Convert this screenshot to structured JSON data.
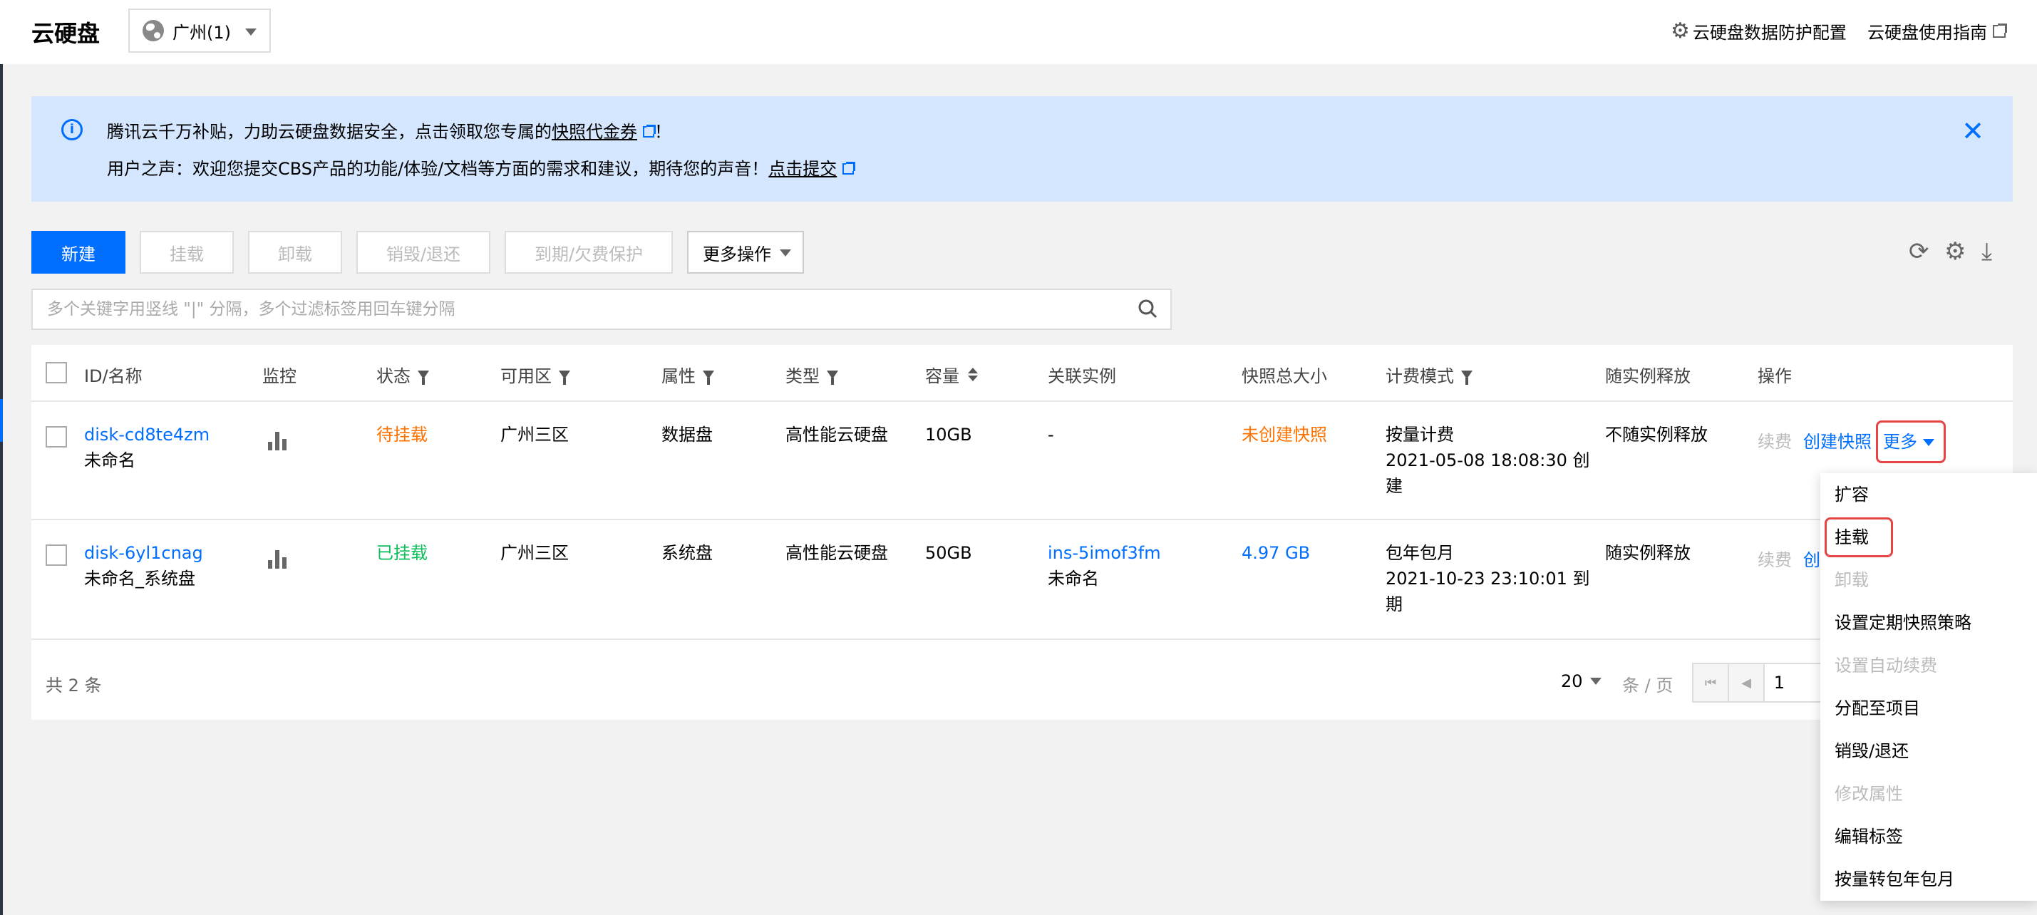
{
  "header": {
    "title": "云硬盘",
    "region": "广州(1)",
    "links": {
      "protection_config": "云硬盘数据防护配置",
      "guide": "云硬盘使用指南"
    }
  },
  "notice": {
    "line1_prefix": "腾讯云千万补贴，力助云硬盘数据安全，点击领取您专属的",
    "line1_link": "快照代金券",
    "line1_suffix": "！",
    "line2_prefix": "用户之声：欢迎您提交CBS产品的功能/体验/文档等方面的需求和建议，期待您的声音！",
    "line2_link": "点击提交",
    "close": "✕"
  },
  "toolbar": {
    "new": "新建",
    "mount": "挂载",
    "unmount": "卸载",
    "destroy": "销毁/退还",
    "expire_protect": "到期/欠费保护",
    "more_ops": "更多操作"
  },
  "search": {
    "placeholder": "多个关键字用竖线 \"|\" 分隔，多个过滤标签用回车键分隔"
  },
  "table": {
    "headers": {
      "id_name": "ID/名称",
      "monitor": "监控",
      "status": "状态",
      "zone": "可用区",
      "attr": "属性",
      "type": "类型",
      "capacity": "容量",
      "instance": "关联实例",
      "snapshot": "快照总大小",
      "billing": "计费模式",
      "release": "随实例释放",
      "ops": "操作"
    },
    "rows": [
      {
        "id": "disk-cd8te4zm",
        "name": "未命名",
        "status": "待挂载",
        "zone": "广州三区",
        "attr": "数据盘",
        "type": "高性能云硬盘",
        "capacity": "10GB",
        "instance": "-",
        "instance_name": "",
        "snapshot": "未创建快照",
        "billing": "按量计费",
        "billing_time_1": "2021-05-08 18:08:30 创",
        "billing_time_2": "建",
        "release": "不随实例释放",
        "op_renew": "续费",
        "op_snapshot": "创建快照",
        "op_more": "更多"
      },
      {
        "id": "disk-6yl1cnag",
        "name": "未命名_系统盘",
        "status": "已挂载",
        "zone": "广州三区",
        "attr": "系统盘",
        "type": "高性能云硬盘",
        "capacity": "50GB",
        "instance": "ins-5imof3fm",
        "instance_name": "未命名",
        "snapshot": "4.97 GB",
        "billing": "包年包月",
        "billing_time_1": "2021-10-23 23:10:01 到",
        "billing_time_2": "期",
        "release": "随实例释放",
        "op_renew": "续费",
        "op_snapshot": "创"
      }
    ],
    "footer": {
      "total": "共 2 条",
      "page_size": "20",
      "per_page": "条 / 页",
      "page": "1"
    }
  },
  "more_menu": {
    "items": [
      {
        "label": "扩容",
        "disabled": false
      },
      {
        "label": "挂载",
        "disabled": false
      },
      {
        "label": "卸载",
        "disabled": true
      },
      {
        "label": "设置定期快照策略",
        "disabled": false
      },
      {
        "label": "设置自动续费",
        "disabled": true
      },
      {
        "label": "分配至项目",
        "disabled": false
      },
      {
        "label": "销毁/退还",
        "disabled": false
      },
      {
        "label": "修改属性",
        "disabled": true
      },
      {
        "label": "编辑标签",
        "disabled": false
      },
      {
        "label": "按量转包年包月",
        "disabled": false
      }
    ]
  },
  "colors": {
    "primary": "#006eff",
    "warning": "#ff7200",
    "success": "#0abf5b",
    "highlight": "#e54545"
  },
  "icons": [
    "globe-icon",
    "gear-icon",
    "external-link-icon",
    "info-icon",
    "close-icon",
    "refresh-icon",
    "settings-icon",
    "download-icon",
    "search-icon",
    "filter-icon",
    "sort-icon",
    "bar-chart-icon",
    "chevron-down-icon"
  ]
}
